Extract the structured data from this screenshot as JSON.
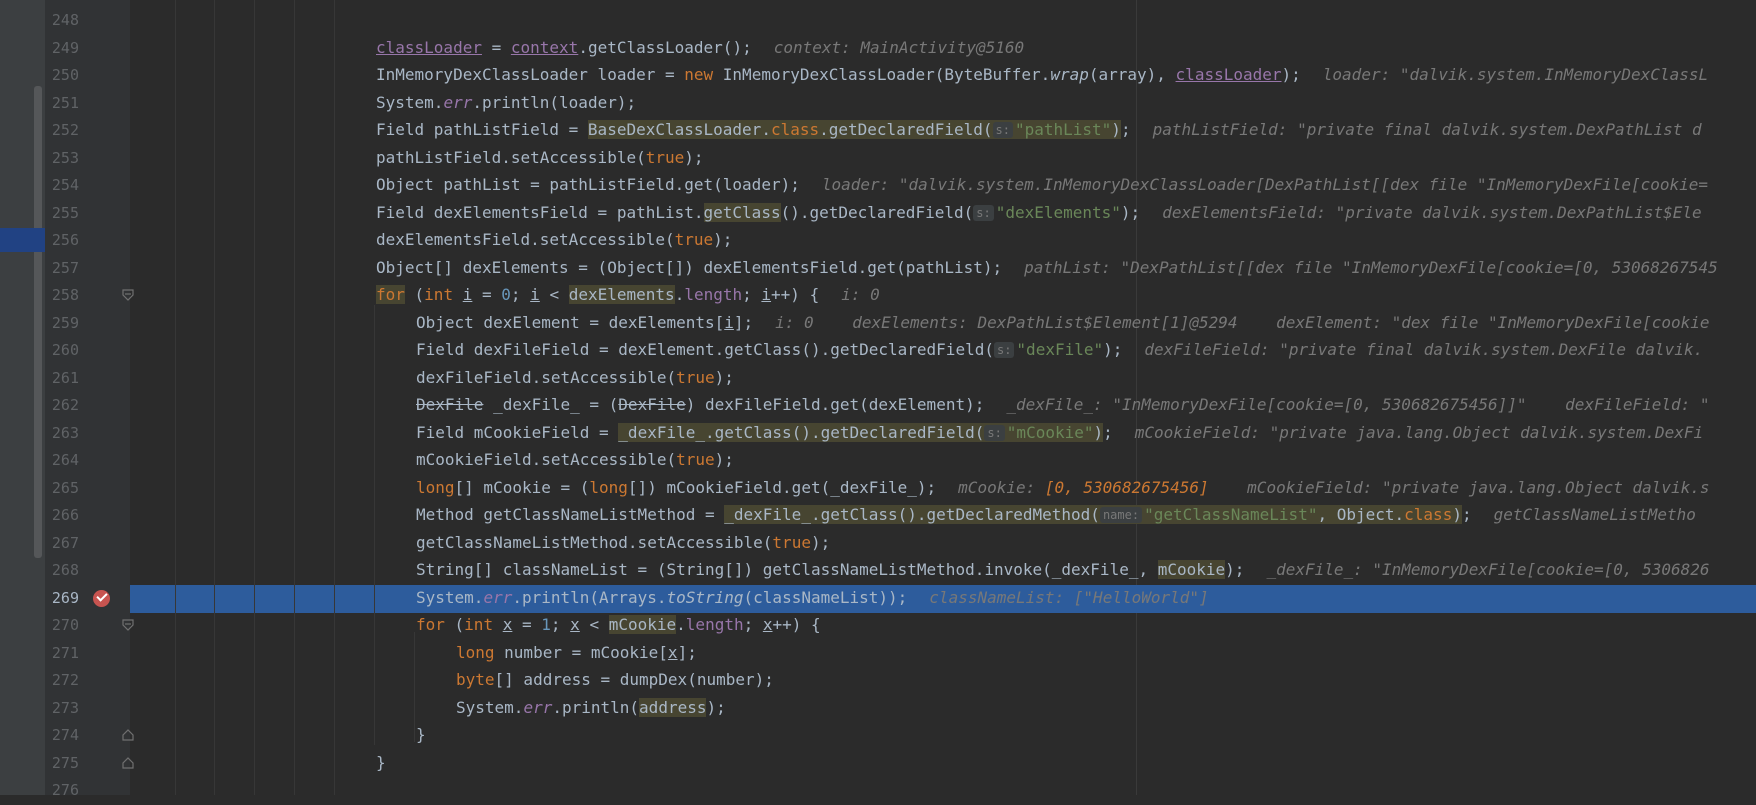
{
  "lines": [
    {
      "num": "248"
    },
    {
      "num": "249",
      "inline": "context: MainActivity@5160"
    },
    {
      "num": "250",
      "inline": "loader: \"dalvik.system.InMemoryDexClassL"
    },
    {
      "num": "251"
    },
    {
      "num": "252",
      "hint": "s:",
      "inline": "pathListField: \"private final dalvik.system.DexPathList d"
    },
    {
      "num": "253"
    },
    {
      "num": "254",
      "inline": "loader: \"dalvik.system.InMemoryDexClassLoader[DexPathList[[dex file \"InMemoryDexFile[cookie="
    },
    {
      "num": "255",
      "hint": "s:",
      "inline": "dexElementsField: \"private dalvik.system.DexPathList$Ele"
    },
    {
      "num": "256"
    },
    {
      "num": "257",
      "inline": "pathList: \"DexPathList[[dex file \"InMemoryDexFile[cookie=[0, 53068267545"
    },
    {
      "num": "258",
      "inline": "i: 0"
    },
    {
      "num": "259",
      "inline": "i: 0    dexElements: DexPathList$Element[1]@5294    dexElement: \"dex file \"InMemoryDexFile[cookie"
    },
    {
      "num": "260",
      "hint": "s:",
      "inline": "dexFileField: \"private final dalvik.system.DexFile dalvik."
    },
    {
      "num": "261"
    },
    {
      "num": "262",
      "inline": "_dexFile_: \"InMemoryDexFile[cookie=[0, 530682675456]]\"    dexFileField: \""
    },
    {
      "num": "263",
      "hint": "s:",
      "inline": "mCookieField: \"private java.lang.Object dalvik.system.DexFi"
    },
    {
      "num": "264"
    },
    {
      "num": "265",
      "inline_label": "mCookie: ",
      "inline_value": "[0, 530682675456]",
      "inline2": "    mCookieField: \"private java.lang.Object dalvik.s"
    },
    {
      "num": "266",
      "hint": "name:",
      "inline": "getClassNameListMetho"
    },
    {
      "num": "267"
    },
    {
      "num": "268",
      "inline": "_dexFile_: \"InMemoryDexFile[cookie=[0, 5306826"
    },
    {
      "num": "269",
      "inline": "classNameList: [\"HelloWorld\"]"
    },
    {
      "num": "270"
    },
    {
      "num": "271"
    },
    {
      "num": "272"
    },
    {
      "num": "273"
    },
    {
      "num": "274"
    },
    {
      "num": "275"
    },
    {
      "num": "276"
    }
  ]
}
